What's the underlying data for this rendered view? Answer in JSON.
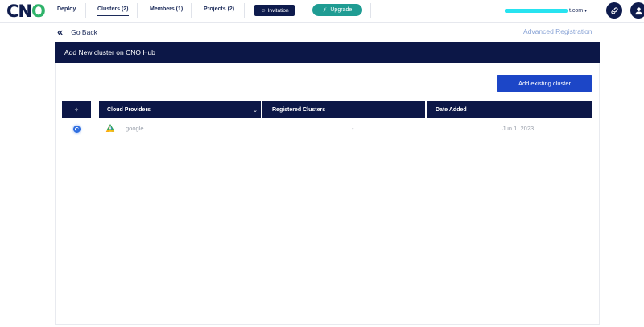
{
  "header": {
    "logo": "CNO",
    "nav": [
      {
        "label": "Deploy"
      },
      {
        "label": "Clusters (2)"
      },
      {
        "label": "Members (1)"
      },
      {
        "label": "Projects (2)"
      }
    ],
    "invitation_label": "Invitation",
    "upgrade_label": "Upgrade",
    "email_suffix": "t.com",
    "icons": [
      "link-icon",
      "user-icon"
    ]
  },
  "subnav": {
    "go_back_label": "Go Back",
    "advanced_registration_label": "Advanced Registration"
  },
  "panel": {
    "title": "Add New cluster on CNO Hub",
    "add_button_label": "Add existing cluster",
    "table": {
      "columns": [
        "Cloud Providers",
        "Registered Clusters",
        "Date Added"
      ],
      "rows": [
        {
          "provider": "google",
          "registered_clusters": "-",
          "date_added": "Jun 1, 2023",
          "selected": true
        }
      ]
    }
  },
  "colors": {
    "navy": "#0c1747",
    "accent_blue": "#1c46c7",
    "upgrade_teal": "#1f9c93",
    "logo_green": "#2fb36a"
  }
}
